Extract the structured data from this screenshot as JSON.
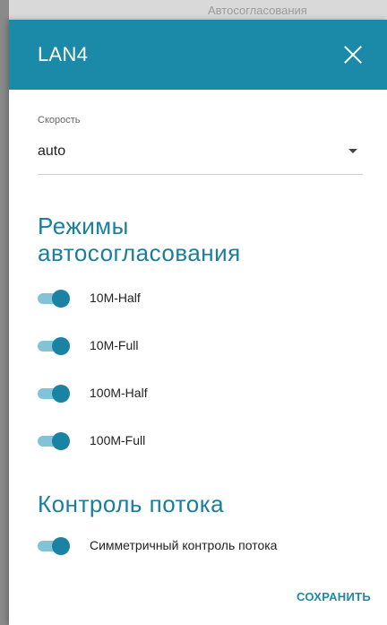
{
  "backdrop": {
    "text": "Автосогласования"
  },
  "dialog": {
    "title": "LAN4",
    "speed": {
      "label": "Скорость",
      "value": "auto"
    },
    "autoneg": {
      "title_line1": "Режимы",
      "title_line2": "автосогласования",
      "modes": [
        {
          "label": "10M-Half",
          "enabled": true
        },
        {
          "label": "10M-Full",
          "enabled": true
        },
        {
          "label": "100M-Half",
          "enabled": true
        },
        {
          "label": "100M-Full",
          "enabled": true
        }
      ]
    },
    "flow_control": {
      "title": "Контроль потока",
      "symmetric": {
        "label": "Симметричный контроль потока",
        "enabled": true
      }
    },
    "save_label": "СОХРАНИТЬ"
  },
  "colors": {
    "accent": "#1a8aa8",
    "toggle_track_on": "#82c3d7",
    "toggle_knob_on": "#1a82a3"
  },
  "icons": {
    "close": "close-icon",
    "dropdown": "chevron-down-icon"
  }
}
